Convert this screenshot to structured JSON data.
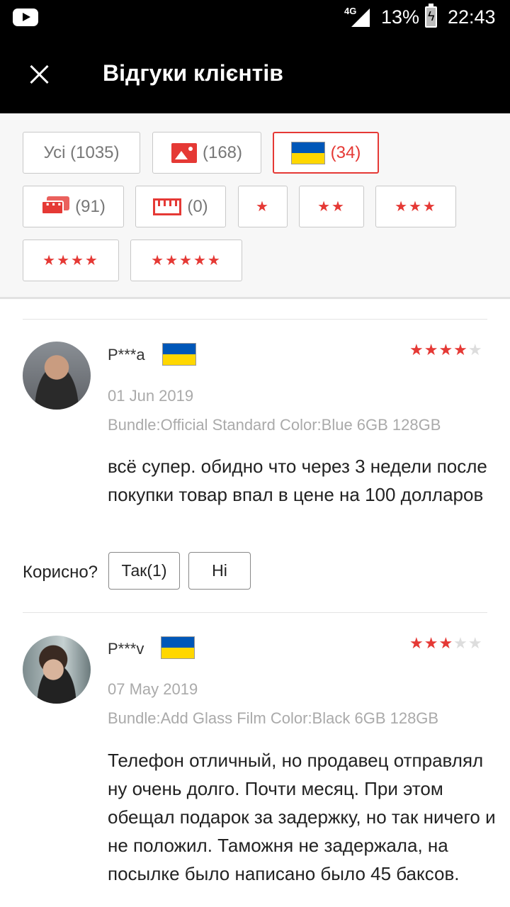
{
  "status_bar": {
    "network": "4G",
    "battery": "13%",
    "battery_symbol": "ϟ",
    "time": "22:43"
  },
  "app_bar": {
    "title": "Відгуки клієнтів"
  },
  "filters": {
    "all": "Усі (1035)",
    "photos": "(168)",
    "ukraine": "(34)",
    "comments": "(91)",
    "size": "(0)",
    "star1": "★",
    "star2": "★★",
    "star3": "★★★",
    "star4": "★★★★",
    "star5": "★★★★★"
  },
  "reviews": [
    {
      "user": "P***a",
      "rating": 4,
      "stars_on": "★★★★",
      "stars_off": "★",
      "date": "01 Jun 2019",
      "bundle": "Bundle:Official Standard Color:Blue 6GB 128GB",
      "text": "всё супер. обидно что через 3 недели после покупки товар впал в цене на 100 долларов",
      "helpful_label": "Корисно?",
      "yes_label": "Так(1)",
      "no_label": "Ні"
    },
    {
      "user": "P***v",
      "rating": 3,
      "stars_on": "★★★",
      "stars_off": "★★",
      "date": "07 May 2019",
      "bundle": "Bundle:Add Glass Film Color:Black 6GB 128GB",
      "text": "Телефон отличный, но продавец отправлял ну очень долго. Почти месяц. При этом обещал подарок за задержку, но так ничего и не положил. Таможня не задержала, на посылке было написано было 45 баксов."
    }
  ],
  "colors": {
    "accent": "#e53935",
    "flag_blue": "#0057b8",
    "flag_yellow": "#ffd700"
  }
}
